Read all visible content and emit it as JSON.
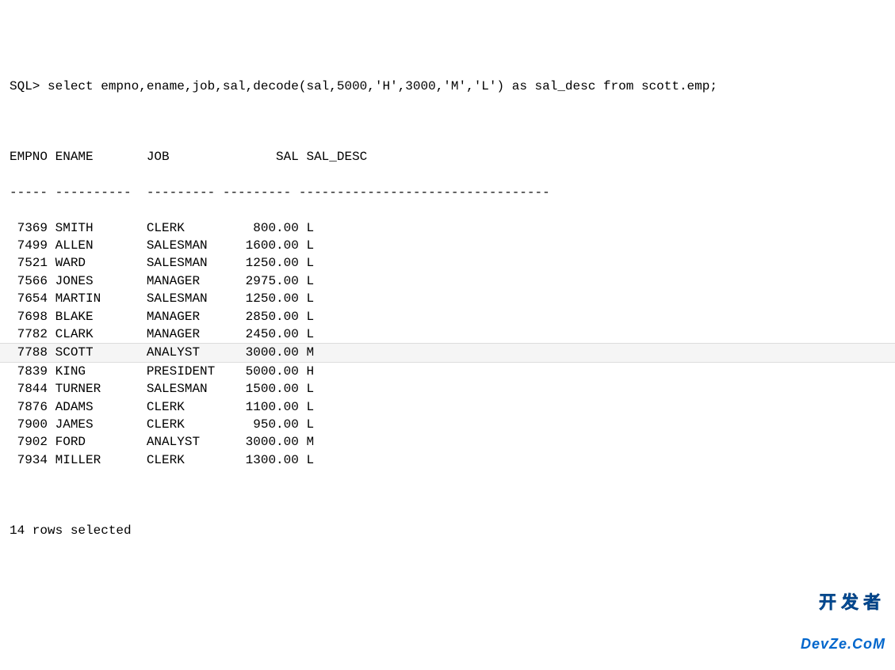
{
  "prompt": "SQL> ",
  "query": "select empno,ename,job,sal,decode(sal,5000,'H',3000,'M','L') as sal_desc from scott.emp;",
  "headers": {
    "empno": "EMPNO",
    "ename": "ENAME",
    "job": "JOB",
    "sal": "SAL",
    "sal_desc": "SAL_DESC"
  },
  "divider": {
    "empno": "-----",
    "ename": "----------",
    "job": "---------",
    "sal": "---------",
    "sal_desc": "---------------------------------"
  },
  "rows": [
    {
      "empno": "7369",
      "ename": "SMITH",
      "job": "CLERK",
      "sal": "800.00",
      "sal_desc": "L",
      "highlight": false
    },
    {
      "empno": "7499",
      "ename": "ALLEN",
      "job": "SALESMAN",
      "sal": "1600.00",
      "sal_desc": "L",
      "highlight": false
    },
    {
      "empno": "7521",
      "ename": "WARD",
      "job": "SALESMAN",
      "sal": "1250.00",
      "sal_desc": "L",
      "highlight": false
    },
    {
      "empno": "7566",
      "ename": "JONES",
      "job": "MANAGER",
      "sal": "2975.00",
      "sal_desc": "L",
      "highlight": false
    },
    {
      "empno": "7654",
      "ename": "MARTIN",
      "job": "SALESMAN",
      "sal": "1250.00",
      "sal_desc": "L",
      "highlight": false
    },
    {
      "empno": "7698",
      "ename": "BLAKE",
      "job": "MANAGER",
      "sal": "2850.00",
      "sal_desc": "L",
      "highlight": false
    },
    {
      "empno": "7782",
      "ename": "CLARK",
      "job": "MANAGER",
      "sal": "2450.00",
      "sal_desc": "L",
      "highlight": false
    },
    {
      "empno": "7788",
      "ename": "SCOTT",
      "job": "ANALYST",
      "sal": "3000.00",
      "sal_desc": "M",
      "highlight": true
    },
    {
      "empno": "7839",
      "ename": "KING",
      "job": "PRESIDENT",
      "sal": "5000.00",
      "sal_desc": "H",
      "highlight": false
    },
    {
      "empno": "7844",
      "ename": "TURNER",
      "job": "SALESMAN",
      "sal": "1500.00",
      "sal_desc": "L",
      "highlight": false
    },
    {
      "empno": "7876",
      "ename": "ADAMS",
      "job": "CLERK",
      "sal": "1100.00",
      "sal_desc": "L",
      "highlight": false
    },
    {
      "empno": "7900",
      "ename": "JAMES",
      "job": "CLERK",
      "sal": "950.00",
      "sal_desc": "L",
      "highlight": false
    },
    {
      "empno": "7902",
      "ename": "FORD",
      "job": "ANALYST",
      "sal": "3000.00",
      "sal_desc": "M",
      "highlight": false
    },
    {
      "empno": "7934",
      "ename": "MILLER",
      "job": "CLERK",
      "sal": "1300.00",
      "sal_desc": "L",
      "highlight": false
    }
  ],
  "footer": "14 rows selected",
  "watermark": {
    "h": "开发者",
    "d": "DevZe.CoM"
  }
}
